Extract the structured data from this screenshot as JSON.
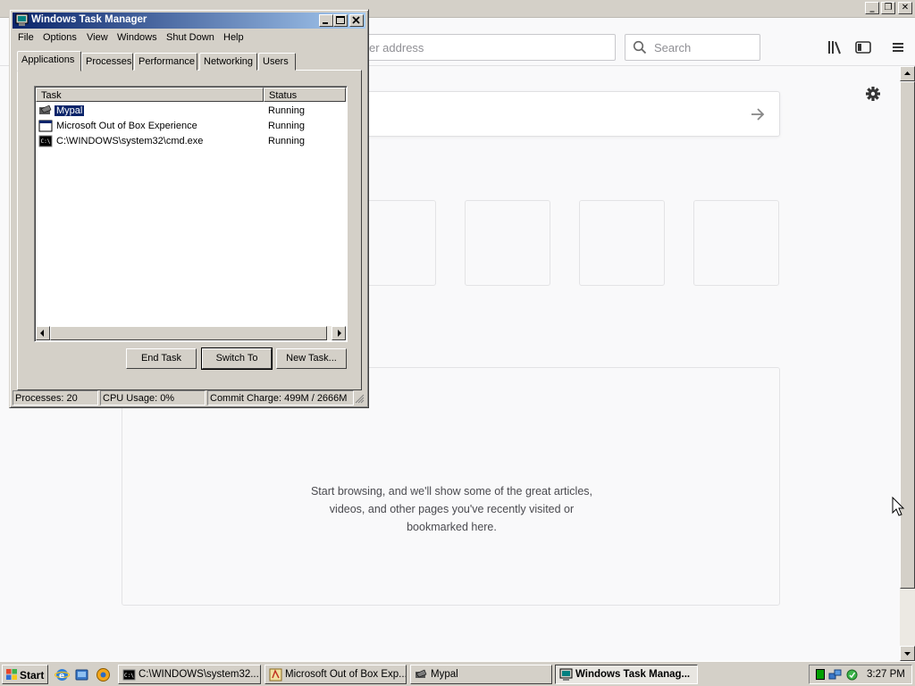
{
  "browser": {
    "urlbar_placeholder": "er address",
    "search_placeholder": "Search",
    "highlights_text": "Start browsing, and we'll show some of the great articles, videos, and other pages you've recently visited or bookmarked here."
  },
  "task_manager": {
    "title": "Windows Task Manager",
    "menu": [
      "File",
      "Options",
      "View",
      "Windows",
      "Shut Down",
      "Help"
    ],
    "tabs": [
      "Applications",
      "Processes",
      "Performance",
      "Networking",
      "Users"
    ],
    "active_tab": "Applications",
    "columns": [
      "Task",
      "Status"
    ],
    "tasks": [
      {
        "name": "Mypal",
        "status": "Running",
        "icon": "mypal-icon",
        "selected": true
      },
      {
        "name": "Microsoft Out of Box Experience",
        "status": "Running",
        "icon": "window-icon",
        "selected": false
      },
      {
        "name": "C:\\WINDOWS\\system32\\cmd.exe",
        "status": "Running",
        "icon": "cmd-icon",
        "selected": false
      }
    ],
    "buttons": {
      "end_task": "End Task",
      "switch_to": "Switch To",
      "new_task": "New Task..."
    },
    "status": {
      "processes": "Processes: 20",
      "cpu": "CPU Usage: 0%",
      "commit": "Commit Charge: 499M / 2666M"
    }
  },
  "taskbar": {
    "start_label": "Start",
    "tasks": [
      {
        "label": "C:\\WINDOWS\\system32...",
        "icon": "cmd-icon",
        "active": false
      },
      {
        "label": "Microsoft Out of Box Exp...",
        "icon": "oobe-icon",
        "active": false
      },
      {
        "label": "Mypal",
        "icon": "mypal-icon",
        "active": false
      },
      {
        "label": "Windows Task Manag...",
        "icon": "taskmgr-icon",
        "active": true
      }
    ],
    "clock": "3:27 PM"
  },
  "colors": {
    "titlebar_active": "#0a246a",
    "selection": "#0a246a",
    "face": "#d4d0c8"
  }
}
